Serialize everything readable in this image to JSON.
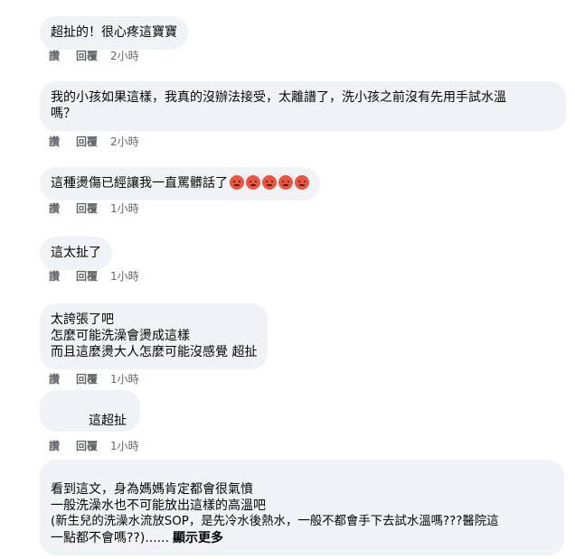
{
  "actions": {
    "like": "讚",
    "reply": "回覆"
  },
  "comments": [
    {
      "lines": [
        "超扯的！很心疼這寶寶"
      ],
      "time": "2小時"
    },
    {
      "lines": [
        "我的小孩如果這樣，我真的沒辦法接受，太離譜了，洗小孩之前沒有先用手試水溫",
        "嗎？"
      ],
      "time": "2小時"
    },
    {
      "lines": [
        "這種燙傷已經讓我一直罵髒話了"
      ],
      "emoji_count": 5,
      "emoji_name": "angry-face-icon",
      "time": "1小時"
    },
    {
      "lines": [
        "這太扯了"
      ],
      "time": "1小時"
    },
    {
      "lines": [
        "太誇張了吧",
        "怎麼可能洗澡會燙成這樣",
        "而且這麼燙大人怎麼可能沒感覺 超扯"
      ],
      "time": "1小時"
    },
    {
      "lines": [
        "這超扯"
      ],
      "time": "1小時"
    },
    {
      "lines": [
        "看到這文，身為媽媽肯定都會很氣憤",
        "一般洗澡水也不可能放出這樣的高溫吧",
        "(新生兒的洗澡水流放SOP，是先冷水後熱水，一般不都會手下去試水溫嗎???醫院這",
        "一點都不會嗎??)......"
      ],
      "see_more": "顯示更多"
    }
  ],
  "colors": {
    "bubble": "#f0f2f5",
    "meta": "#65676b",
    "text": "#050505",
    "emoji": "#e8563f"
  }
}
